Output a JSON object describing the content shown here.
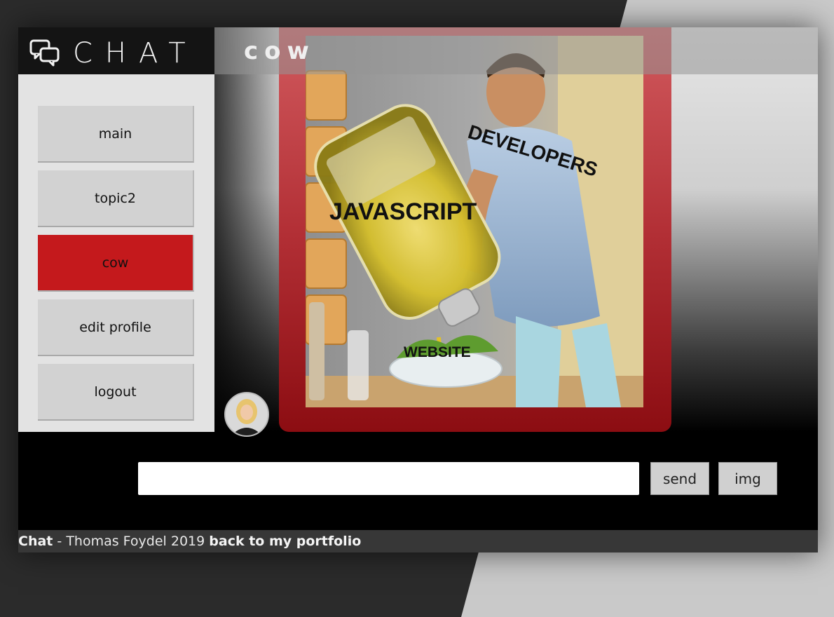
{
  "brand": {
    "name": "CHAT",
    "icon": "chat-bubbles-icon"
  },
  "sidebar": {
    "items": [
      {
        "label": "main"
      },
      {
        "label": "topic2"
      },
      {
        "label": "cow",
        "active": true
      },
      {
        "label": "edit profile"
      },
      {
        "label": "logout"
      }
    ]
  },
  "topic": {
    "title": "cow"
  },
  "message": {
    "image_labels": {
      "developers": "DEVELOPERS",
      "javascript": "JAVASCRIPT",
      "website": "WEBSITE"
    }
  },
  "composer": {
    "input_value": "",
    "send_label": "send",
    "img_label": "img"
  },
  "footer": {
    "app": "Chat",
    "separator": " - ",
    "credit": "Thomas Foydel 2019 ",
    "link": "back to my portfolio"
  },
  "colors": {
    "accent_red": "#c4191c",
    "card_red": "#b33036",
    "dark": "#141414"
  }
}
